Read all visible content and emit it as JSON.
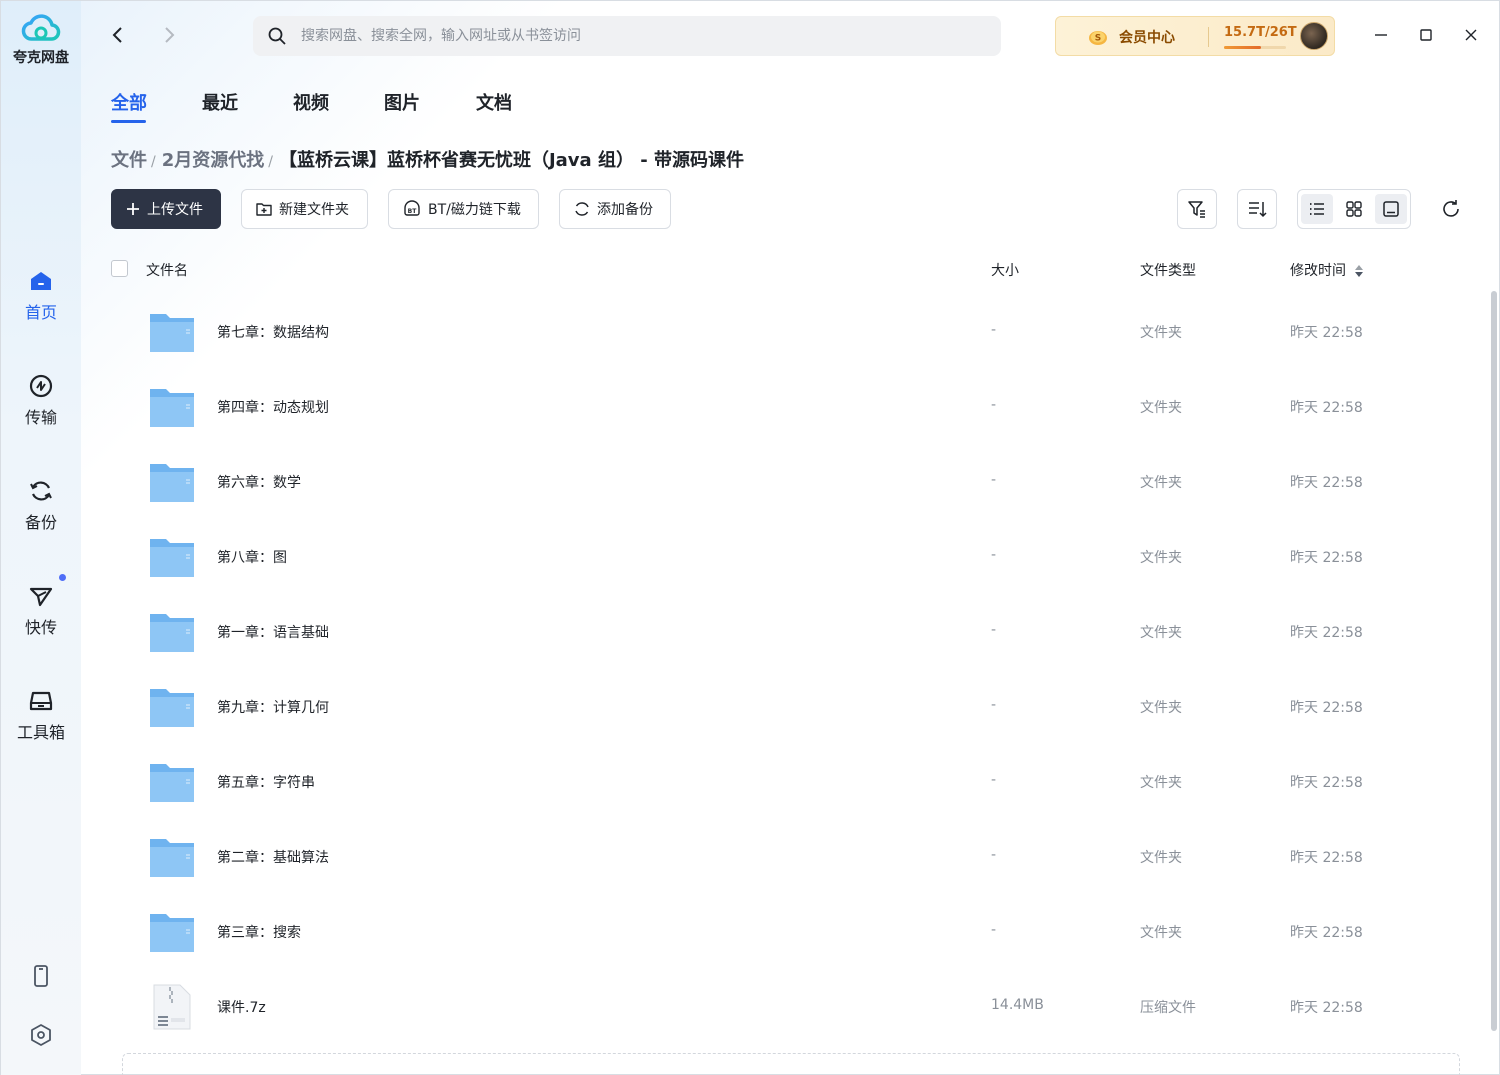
{
  "app": {
    "name": "夸克网盘"
  },
  "sidebar": {
    "items": [
      {
        "label": "首页",
        "icon": "home-icon",
        "active": true
      },
      {
        "label": "传输",
        "icon": "transfer-icon",
        "active": false
      },
      {
        "label": "备份",
        "icon": "backup-icon",
        "active": false
      },
      {
        "label": "快传",
        "icon": "quick-send-icon",
        "active": false,
        "badge_dot": true
      },
      {
        "label": "工具箱",
        "icon": "toolbox-icon",
        "active": false
      }
    ],
    "bottom_icons": [
      "phone-icon",
      "settings-icon"
    ]
  },
  "topbar": {
    "search_placeholder": "搜索网盘、搜索全网，输入网址或从书签访问",
    "vip_label": "会员中心",
    "storage_text": "15.7T/26T",
    "storage_fraction": 0.6
  },
  "tabs": [
    {
      "label": "全部",
      "active": true
    },
    {
      "label": "最近",
      "active": false
    },
    {
      "label": "视频",
      "active": false
    },
    {
      "label": "图片",
      "active": false
    },
    {
      "label": "文档",
      "active": false
    }
  ],
  "breadcrumb": [
    "文件",
    "2月资源代找",
    "【蓝桥云课】蓝桥杯省赛无忧班（Java 组） - 带源码课件"
  ],
  "toolbar": {
    "upload_label": "上传文件",
    "new_folder_label": "新建文件夹",
    "bt_label": "BT/磁力链下载",
    "backup_label": "添加备份"
  },
  "columns": {
    "name": "文件名",
    "size": "大小",
    "type": "文件类型",
    "modified": "修改时间"
  },
  "files": [
    {
      "name": "第七章：数据结构",
      "size": "-",
      "type": "文件夹",
      "modified": "昨天 22:58",
      "kind": "folder"
    },
    {
      "name": "第四章：动态规划",
      "size": "-",
      "type": "文件夹",
      "modified": "昨天 22:58",
      "kind": "folder"
    },
    {
      "name": "第六章：数学",
      "size": "-",
      "type": "文件夹",
      "modified": "昨天 22:58",
      "kind": "folder"
    },
    {
      "name": "第八章：图",
      "size": "-",
      "type": "文件夹",
      "modified": "昨天 22:58",
      "kind": "folder"
    },
    {
      "name": "第一章：语言基础",
      "size": "-",
      "type": "文件夹",
      "modified": "昨天 22:58",
      "kind": "folder"
    },
    {
      "name": "第九章：计算几何",
      "size": "-",
      "type": "文件夹",
      "modified": "昨天 22:58",
      "kind": "folder"
    },
    {
      "name": "第五章：字符串",
      "size": "-",
      "type": "文件夹",
      "modified": "昨天 22:58",
      "kind": "folder"
    },
    {
      "name": "第二章：基础算法",
      "size": "-",
      "type": "文件夹",
      "modified": "昨天 22:58",
      "kind": "folder"
    },
    {
      "name": "第三章：搜索",
      "size": "-",
      "type": "文件夹",
      "modified": "昨天 22:58",
      "kind": "folder"
    },
    {
      "name": "课件.7z",
      "size": "14.4MB",
      "type": "压缩文件",
      "modified": "昨天 22:58",
      "kind": "archive"
    }
  ],
  "colors": {
    "accent": "#2563eb",
    "primary_button": "#2d3445",
    "folder": "#6fb3ef"
  }
}
